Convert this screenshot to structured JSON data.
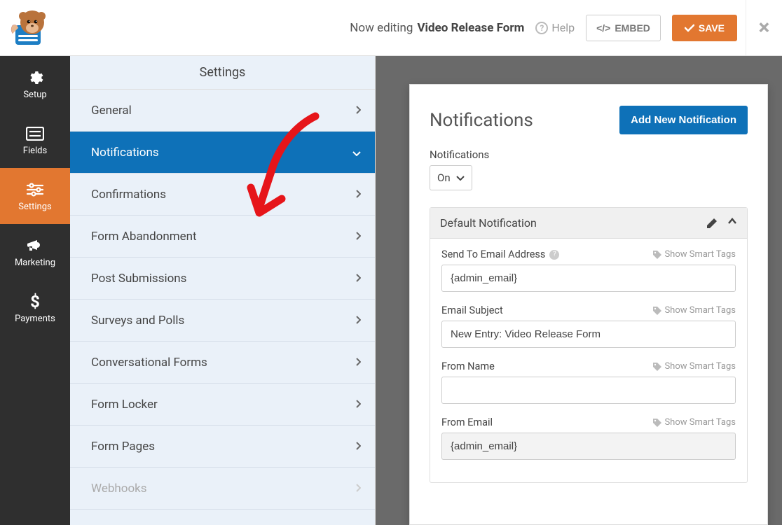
{
  "header": {
    "editing_prefix": "Now editing",
    "form_name": "Video Release Form",
    "help_label": "Help",
    "embed_label": "EMBED",
    "save_label": "SAVE"
  },
  "sidebar": {
    "items": [
      {
        "id": "setup",
        "label": "Setup"
      },
      {
        "id": "fields",
        "label": "Fields"
      },
      {
        "id": "settings",
        "label": "Settings"
      },
      {
        "id": "marketing",
        "label": "Marketing"
      },
      {
        "id": "payments",
        "label": "Payments"
      }
    ],
    "active": "settings"
  },
  "settings_panel": {
    "header": "Settings",
    "items": [
      {
        "label": "General"
      },
      {
        "label": "Notifications",
        "selected": true
      },
      {
        "label": "Confirmations"
      },
      {
        "label": "Form Abandonment"
      },
      {
        "label": "Post Submissions"
      },
      {
        "label": "Surveys and Polls"
      },
      {
        "label": "Conversational Forms"
      },
      {
        "label": "Form Locker"
      },
      {
        "label": "Form Pages"
      },
      {
        "label": "Webhooks",
        "disabled": true
      }
    ]
  },
  "main": {
    "title": "Notifications",
    "add_button": "Add New Notification",
    "toggle_label": "Notifications",
    "toggle_value": "On",
    "notification": {
      "title": "Default Notification",
      "smart_tag_label": "Show Smart Tags",
      "fields": {
        "send_to": {
          "label": "Send To Email Address",
          "value": "{admin_email}",
          "has_help": true,
          "has_smart": true
        },
        "subject": {
          "label": "Email Subject",
          "value": "New Entry: Video Release Form",
          "has_smart": true
        },
        "from_name": {
          "label": "From Name",
          "value": "",
          "has_smart": true
        },
        "from_email": {
          "label": "From Email",
          "value": "{admin_email}",
          "has_smart": true,
          "readonly": true
        }
      }
    }
  },
  "colors": {
    "accent_orange": "#e27730",
    "accent_blue": "#0e71b8",
    "sidebar_dark": "#2f2f2f",
    "panel_bg": "#eaf1f9"
  }
}
